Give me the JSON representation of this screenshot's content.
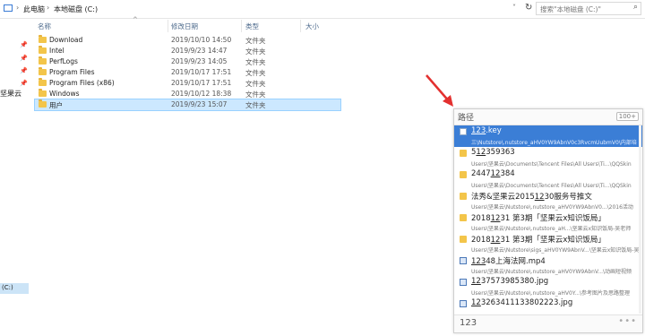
{
  "address": {
    "crumbs": [
      "此电脑",
      "本地磁盘 (C:)"
    ],
    "separator": "›",
    "dropdown": "˅",
    "refresh": "↻"
  },
  "search": {
    "placeholder": "搜索\"本地磁盘 (C:)\"",
    "icon": "search-icon"
  },
  "nav": {
    "item_label": "坚果云",
    "drive_label": "(C:)",
    "pin_icon": "📌",
    "pin_count": 4
  },
  "columns": {
    "name": "名称",
    "date": "修改日期",
    "type": "类型",
    "size": "大小",
    "sort_indicator": "^"
  },
  "files": [
    {
      "name": "Download",
      "date": "2019/10/10 14:50",
      "type": "文件夹"
    },
    {
      "name": "Intel",
      "date": "2019/9/23 14:47",
      "type": "文件夹"
    },
    {
      "name": "PerfLogs",
      "date": "2019/9/23 14:05",
      "type": "文件夹"
    },
    {
      "name": "Program Files",
      "date": "2019/10/17 17:51",
      "type": "文件夹"
    },
    {
      "name": "Program Files (x86)",
      "date": "2019/10/17 17:51",
      "type": "文件夹"
    },
    {
      "name": "Windows",
      "date": "2019/10/12 18:38",
      "type": "文件夹"
    },
    {
      "name": "用户",
      "date": "2019/9/23 15:07",
      "type": "文件夹",
      "selected": true
    }
  ],
  "panel": {
    "title": "路径",
    "count": "100+",
    "query": "123",
    "more": "•••",
    "results": [
      {
        "pre": "",
        "hl": "123",
        "post": ".key",
        "path": "三\\Nutstore\\.nutstore_aHV0YW9AbnV0c3RvcmUubmV0\\内部培",
        "icon": "file",
        "selected": true
      },
      {
        "pre": "5",
        "hl": "12",
        "post": "359363",
        "path": "Users\\坚果云\\Documents\\Tencent Files\\All Users\\Ti...\\QQSkin",
        "icon": "folder"
      },
      {
        "pre": "2447",
        "hl": "12",
        "post": "384",
        "path": "Users\\坚果云\\Documents\\Tencent Files\\All Users\\Ti...\\QQSkin",
        "icon": "folder"
      },
      {
        "pre": "法秀&坚果云2015",
        "hl": "12",
        "post": "30服务号推文",
        "path": "Users\\坚果云\\Nutstore\\.nutstore_aHV0YW9AbnV0...\\2016活动",
        "icon": "folder"
      },
      {
        "pre": "2018",
        "hl": "12",
        "post": "31 第3期「坚果云x知识饭局」",
        "path": "Users\\坚果云\\Nutstore\\.nutstore_aH...\\坚果云x知识饭局-吴老师",
        "icon": "folder"
      },
      {
        "pre": "2018",
        "hl": "12",
        "post": "31 第3期「坚果云x知识饭局」",
        "path": "Users\\坚果云\\Nutstore\\sigs_aHV0YW9AbnV...\\坚果云x知识饭局-吴老师",
        "icon": "folder"
      },
      {
        "pre": "",
        "hl": "123",
        "post": "48上海法网.mp4",
        "path": "Users\\坚果云\\Nutstore\\.nutstore_aHV0YW9AbnV...\\动画短视频",
        "icon": "media"
      },
      {
        "pre": "",
        "hl": "12",
        "post": "37573985380.jpg",
        "path": "Users\\坚果云\\Nutstore\\.nutstore_aHV0Y...\\参考图片及思路整理",
        "icon": "media"
      },
      {
        "pre": "",
        "hl": "12",
        "post": "3263411133802223.jpg",
        "path": "",
        "icon": "media"
      }
    ]
  }
}
